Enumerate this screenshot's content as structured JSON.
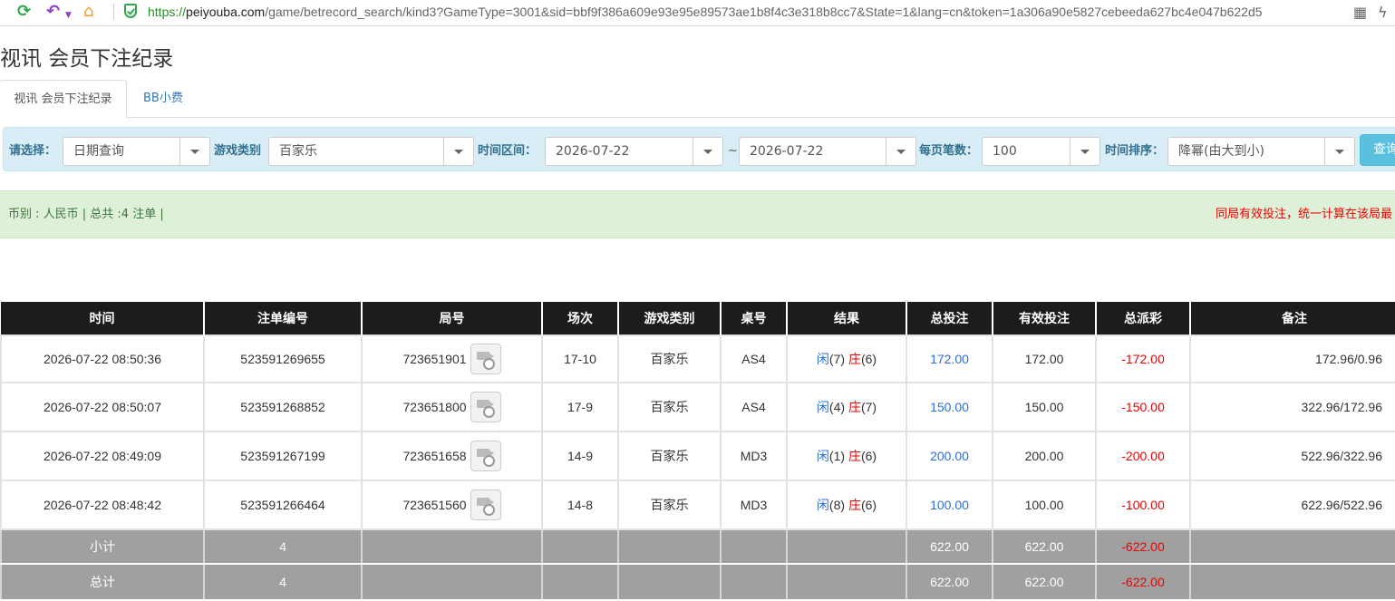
{
  "browser": {
    "url_scheme": "https://",
    "url_host": "peiyouba.com",
    "url_path": "/game/betrecord_search/kind3?GameType=3001&sid=bbf9f386a609e93e95e89573ae1b8f4c3e318b8cc7&State=1&lang=cn&token=1a306a90e5827cebeeda627bc4e047b622d5"
  },
  "page_title": "视讯 会员下注纪录",
  "tabs": [
    {
      "label": "视讯 会员下注纪录"
    },
    {
      "label": "BB小费"
    }
  ],
  "filter": {
    "select_label": "请选择：",
    "select_value": "日期查询",
    "game_type_label": "游戏类别",
    "game_type_value": "百家乐",
    "time_range_label": "时间区间：",
    "date_from": "2026-07-22",
    "tilde": "~",
    "date_to": "2026-07-22",
    "per_page_label": "每页笔数：",
    "per_page_value": "100",
    "sort_label": "时间排序：",
    "sort_value": "降幂(由大到小)",
    "query_button": "查询"
  },
  "summary": {
    "left": "币别 : 人民币 | 总共 :4 注单 |",
    "right": "同局有效投注，统一计算在该局最"
  },
  "table": {
    "headers": [
      "时间",
      "注单编号",
      "局号",
      "场次",
      "游戏类别",
      "桌号",
      "结果",
      "总投注",
      "有效投注",
      "总派彩",
      "备注"
    ],
    "rows": [
      {
        "time": "2026-07-22 08:50:36",
        "bet_no": "523591269655",
        "round": "723651901",
        "session": "17-10",
        "game": "百家乐",
        "table": "AS4",
        "player": "闲",
        "player_pts": "(7)",
        "banker": "庄",
        "banker_pts": "(6)",
        "total_bet": "172.00",
        "valid_bet": "172.00",
        "payout": "-172.00",
        "remark": "172.96/0.96"
      },
      {
        "time": "2026-07-22 08:50:07",
        "bet_no": "523591268852",
        "round": "723651800",
        "session": "17-9",
        "game": "百家乐",
        "table": "AS4",
        "player": "闲",
        "player_pts": "(4)",
        "banker": "庄",
        "banker_pts": "(7)",
        "total_bet": "150.00",
        "valid_bet": "150.00",
        "payout": "-150.00",
        "remark": "322.96/172.96"
      },
      {
        "time": "2026-07-22 08:49:09",
        "bet_no": "523591267199",
        "round": "723651658",
        "session": "14-9",
        "game": "百家乐",
        "table": "MD3",
        "player": "闲",
        "player_pts": "(1)",
        "banker": "庄",
        "banker_pts": "(6)",
        "total_bet": "200.00",
        "valid_bet": "200.00",
        "payout": "-200.00",
        "remark": "522.96/322.96"
      },
      {
        "time": "2026-07-22 08:48:42",
        "bet_no": "523591266464",
        "round": "723651560",
        "session": "14-8",
        "game": "百家乐",
        "table": "MD3",
        "player": "闲",
        "player_pts": "(8)",
        "banker": "庄",
        "banker_pts": "(6)",
        "total_bet": "100.00",
        "valid_bet": "100.00",
        "payout": "-100.00",
        "remark": "622.96/522.96"
      }
    ],
    "subtotal": {
      "label": "小计",
      "count": "4",
      "total_bet": "622.00",
      "valid_bet": "622.00",
      "payout": "-622.00"
    },
    "total": {
      "label": "总计",
      "count": "4",
      "total_bet": "622.00",
      "valid_bet": "622.00",
      "payout": "-622.00"
    }
  },
  "colors": {
    "player": "#2a6fd8",
    "banker": "#e00000",
    "header_bg": "#1c1c1c",
    "total_bg": "#a0a0a0"
  }
}
